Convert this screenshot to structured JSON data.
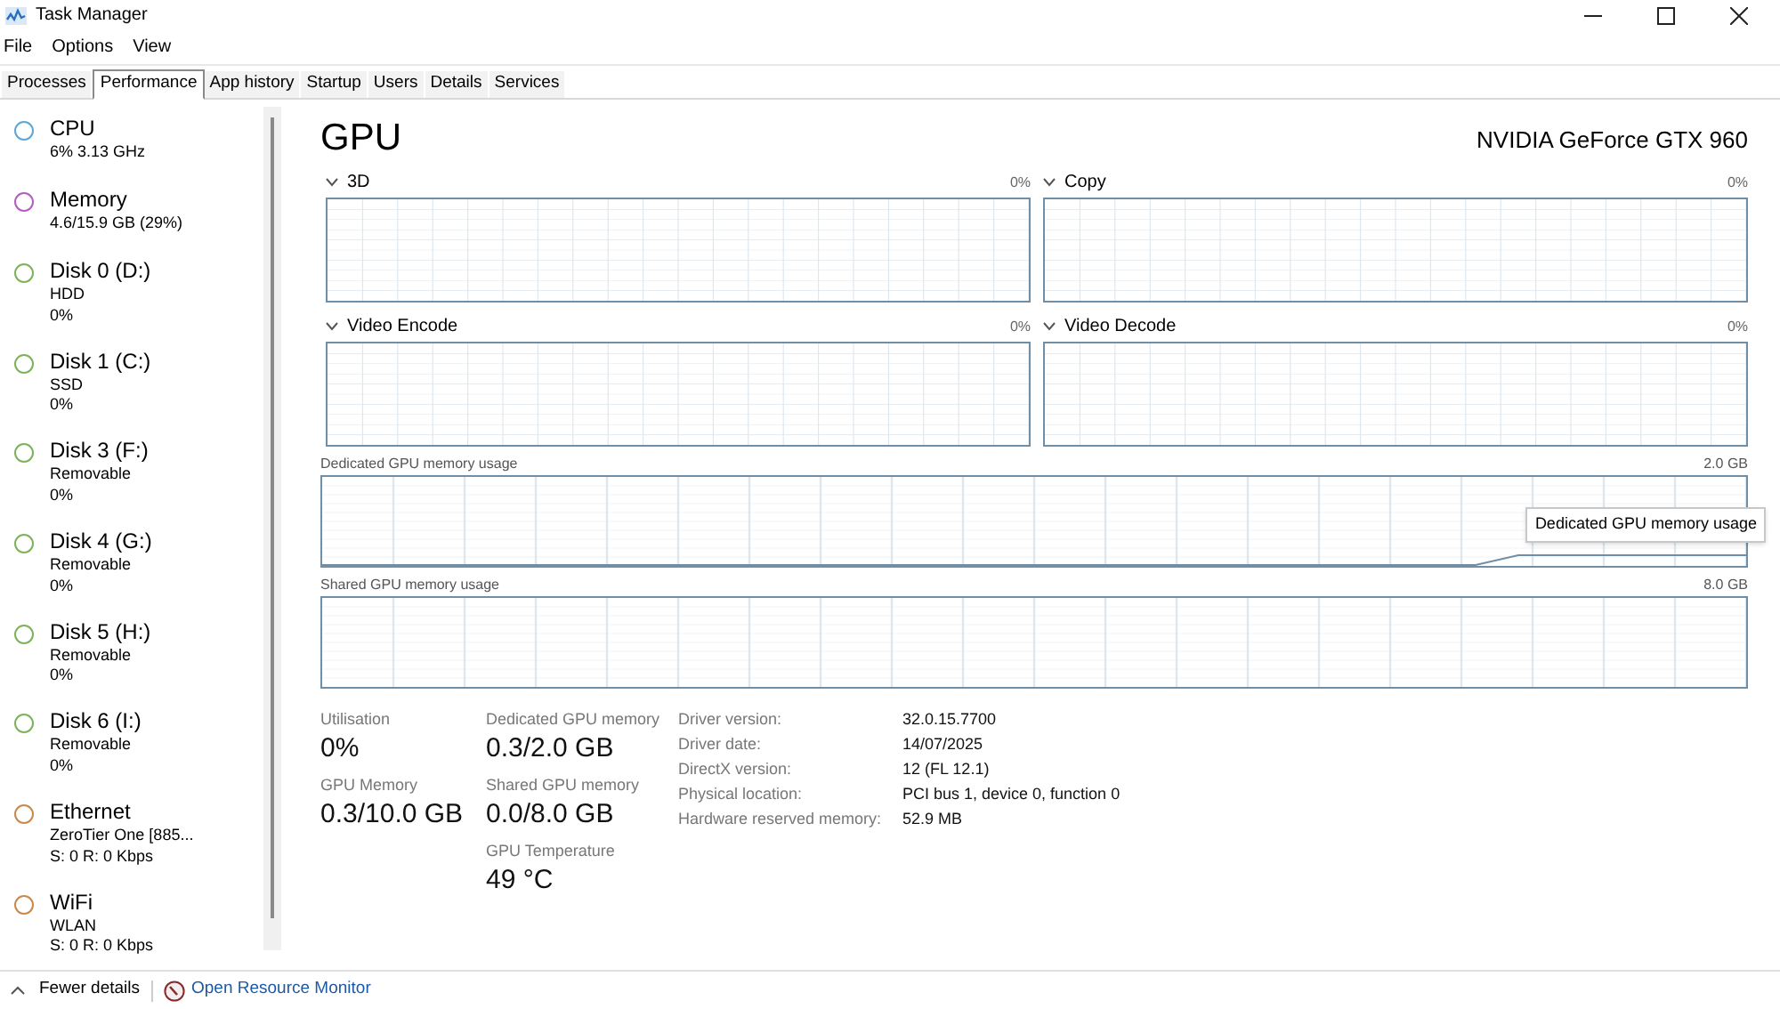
{
  "window": {
    "title": "Task Manager"
  },
  "menu": [
    "File",
    "Options",
    "View"
  ],
  "tabs": [
    {
      "label": "Processes",
      "selected": false
    },
    {
      "label": "Performance",
      "selected": true
    },
    {
      "label": "App history",
      "selected": false
    },
    {
      "label": "Startup",
      "selected": false
    },
    {
      "label": "Users",
      "selected": false
    },
    {
      "label": "Details",
      "selected": false
    },
    {
      "label": "Services",
      "selected": false
    }
  ],
  "sidebar": {
    "items": [
      {
        "name": "CPU",
        "lines": [
          "6%  3.13 GHz"
        ],
        "color": "#5ea6d6"
      },
      {
        "name": "Memory",
        "lines": [
          "4.6/15.9 GB (29%)"
        ],
        "color": "#b25ec0"
      },
      {
        "name": "Disk 0 (D:)",
        "lines": [
          "HDD",
          "0%"
        ],
        "color": "#7cb35a"
      },
      {
        "name": "Disk 1 (C:)",
        "lines": [
          "SSD",
          "0%"
        ],
        "color": "#7cb35a"
      },
      {
        "name": "Disk 3 (F:)",
        "lines": [
          "Removable",
          "0%"
        ],
        "color": "#7cb35a"
      },
      {
        "name": "Disk 4 (G:)",
        "lines": [
          "Removable",
          "0%"
        ],
        "color": "#7cb35a"
      },
      {
        "name": "Disk 5 (H:)",
        "lines": [
          "Removable",
          "0%"
        ],
        "color": "#7cb35a"
      },
      {
        "name": "Disk 6 (I:)",
        "lines": [
          "Removable",
          "0%"
        ],
        "color": "#7cb35a"
      },
      {
        "name": "Ethernet",
        "lines": [
          "ZeroTier One [885...",
          "S: 0 R: 0 Kbps"
        ],
        "color": "#c9894a"
      },
      {
        "name": "WiFi",
        "lines": [
          "WLAN",
          "S: 0 R: 0 Kbps"
        ],
        "color": "#c9894a"
      }
    ]
  },
  "gpu": {
    "title": "GPU",
    "model": "NVIDIA GeForce GTX 960",
    "engines": [
      {
        "label": "3D",
        "reading": "0%"
      },
      {
        "label": "Copy",
        "reading": "0%"
      },
      {
        "label": "Video Encode",
        "reading": "0%"
      },
      {
        "label": "Video Decode",
        "reading": "0%"
      }
    ],
    "memory_graphs": [
      {
        "label": "Dedicated GPU memory usage",
        "max": "2.0 GB",
        "tooltip": "Dedicated GPU memory usage"
      },
      {
        "label": "Shared GPU memory usage",
        "max": "8.0 GB"
      }
    ],
    "stat_columns": [
      [
        {
          "label": "Utilisation",
          "value": "0%"
        },
        {
          "label": "GPU Memory",
          "value": "0.3/10.0 GB"
        }
      ],
      [
        {
          "label": "Dedicated GPU memory",
          "value": "0.3/2.0 GB"
        },
        {
          "label": "Shared GPU memory",
          "value": "0.0/8.0 GB"
        },
        {
          "label": "GPU Temperature",
          "value": "49 °C"
        }
      ]
    ],
    "details": [
      {
        "label": "Driver version:",
        "value": "32.0.15.7700"
      },
      {
        "label": "Driver date:",
        "value": "14/07/2025"
      },
      {
        "label": "DirectX version:",
        "value": "12 (FL 12.1)"
      },
      {
        "label": "Physical location:",
        "value": "PCI bus 1, device 0, function 0"
      },
      {
        "label": "Hardware reserved memory:",
        "value": "52.9 MB"
      }
    ]
  },
  "footer": {
    "fewer_details": "Fewer details",
    "resource_monitor": "Open Resource Monitor"
  }
}
